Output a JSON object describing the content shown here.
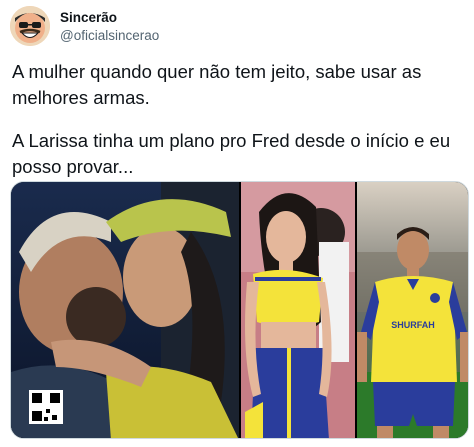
{
  "author": {
    "display_name": "Sincerão",
    "handle": "@oficialsincerao",
    "avatar_icon": "cartoon-face-avatar"
  },
  "tweet": {
    "paragraphs": [
      "A mulher quando quer não tem jeito, sabe usar as melhores armas.",
      "A Larissa tinha um plano pro Fred desde o início e eu posso provar..."
    ]
  },
  "media": {
    "images": [
      {
        "subject": "couple-kiss-photo"
      },
      {
        "subject": "woman-yellow-top-photo"
      },
      {
        "subject": "soccer-player-photo"
      }
    ],
    "jersey_sponsor": "SHURFAH"
  },
  "colors": {
    "text": "#0f1419",
    "secondary": "#536471",
    "jersey_yellow": "#f4e33a",
    "jersey_blue": "#2a3d9c"
  }
}
